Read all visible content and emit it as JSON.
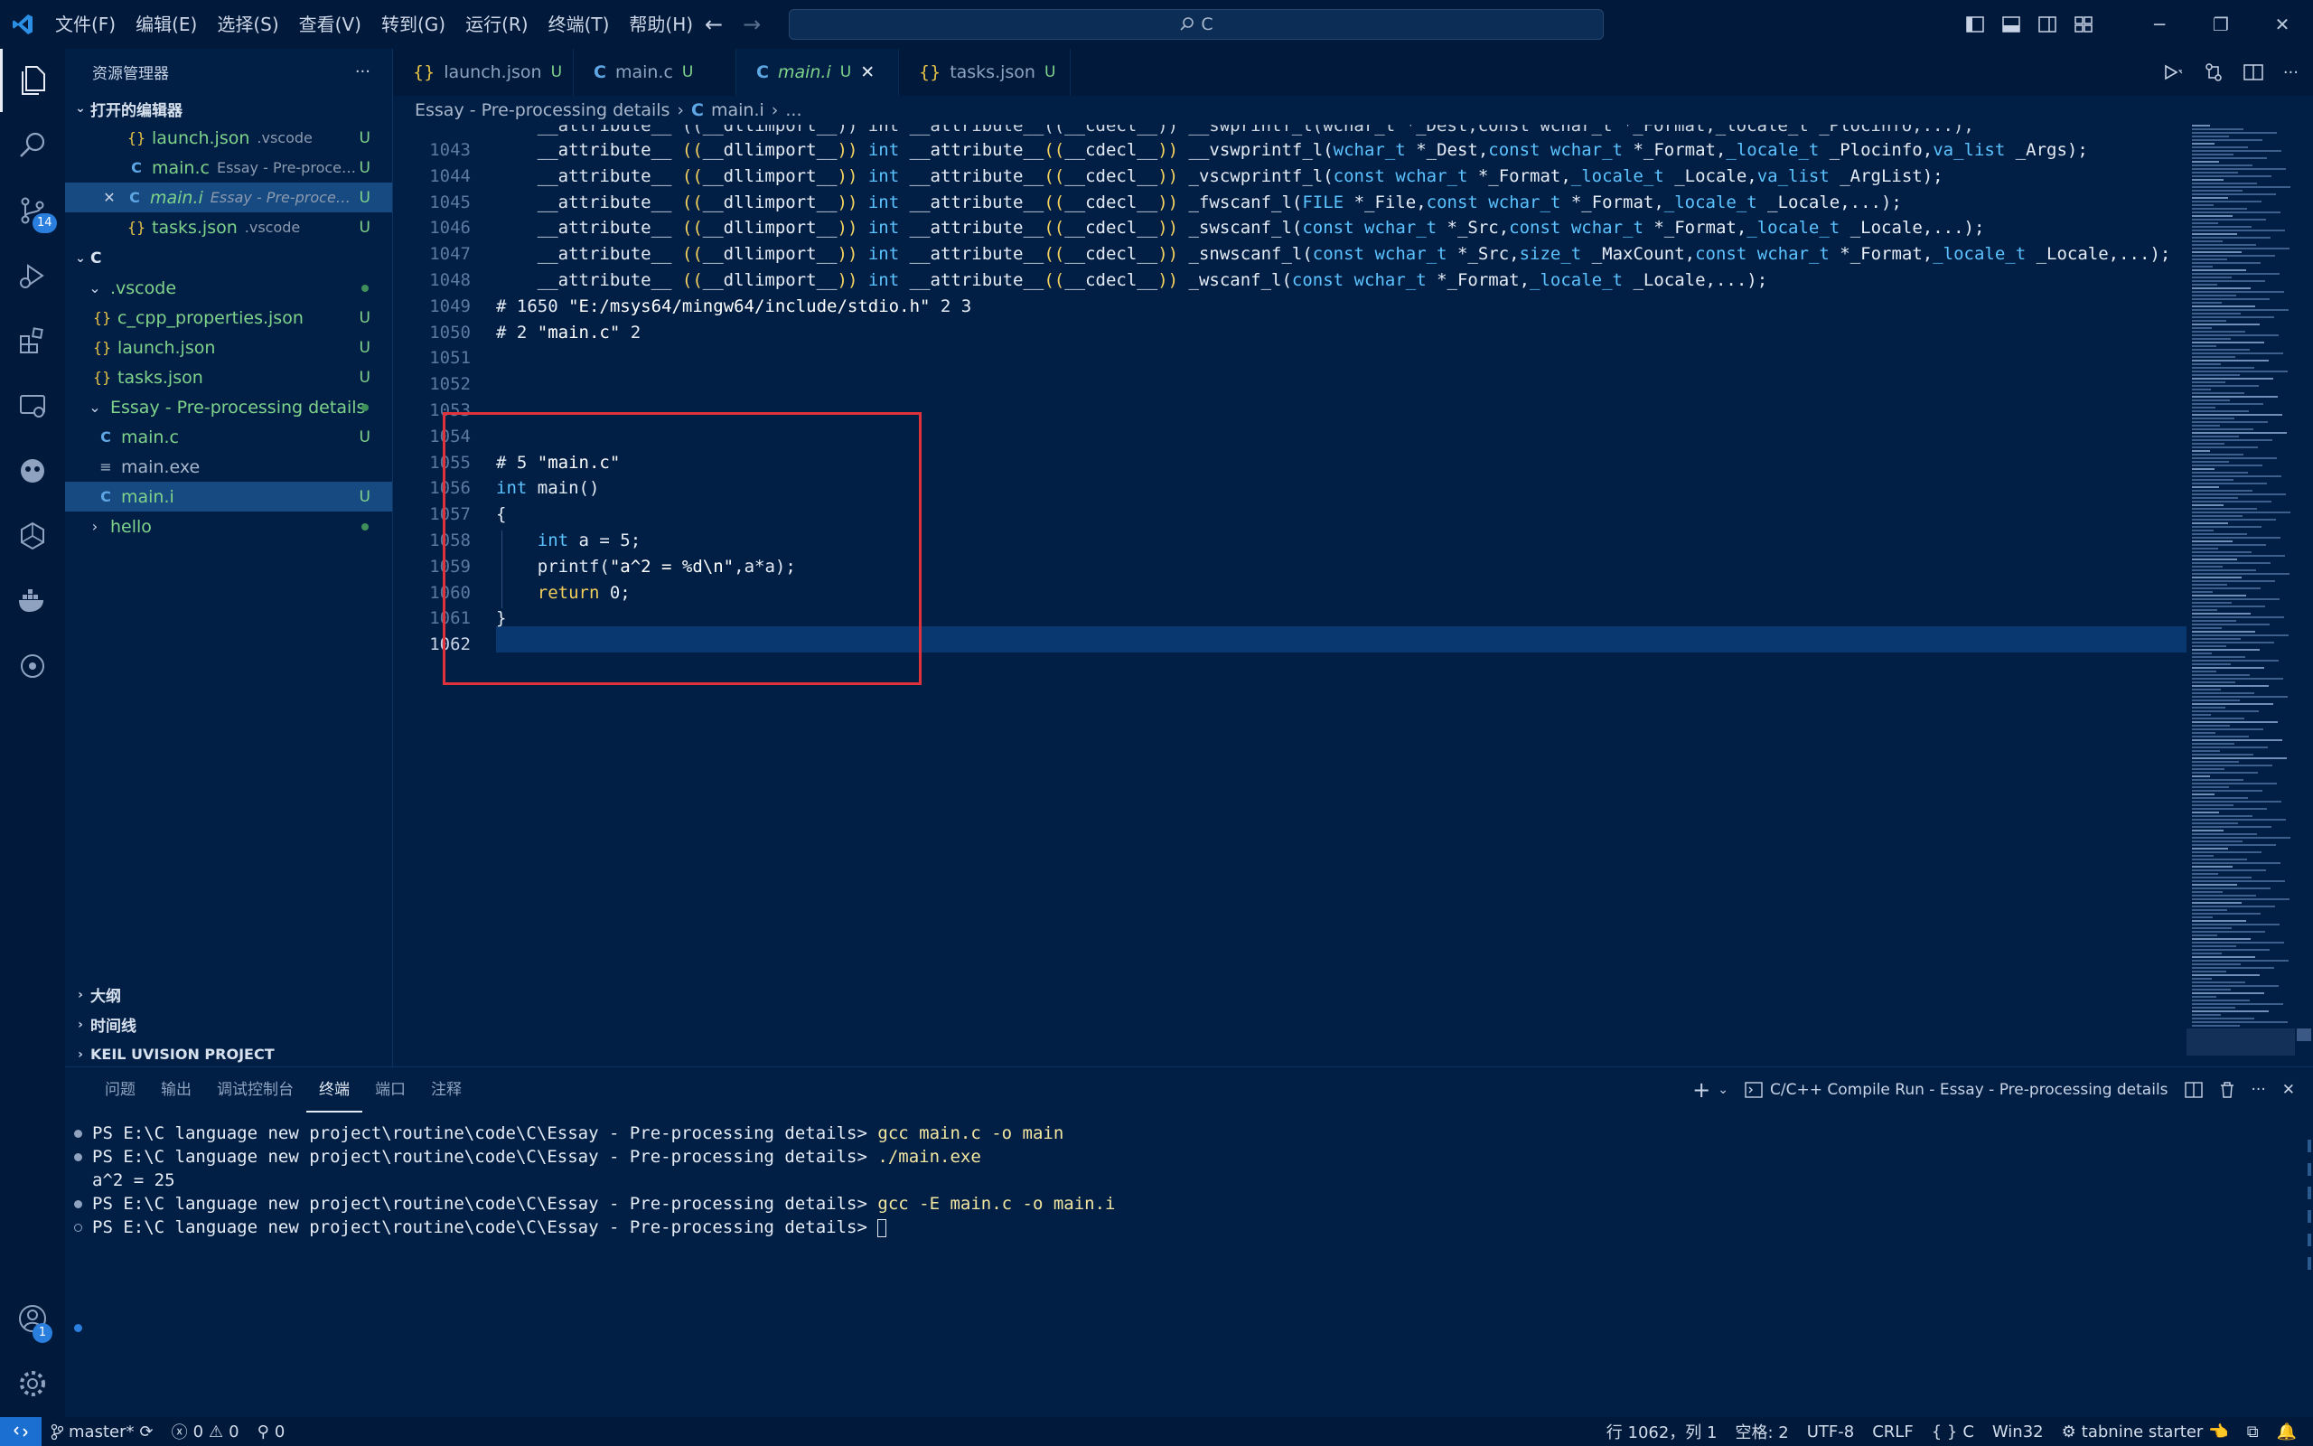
{
  "menu": [
    "文件(F)",
    "编辑(E)",
    "选择(S)",
    "查看(V)",
    "转到(G)",
    "运行(R)",
    "终端(T)",
    "帮助(H)"
  ],
  "search": {
    "text": "C"
  },
  "activity": {
    "scm_badge": "14",
    "accounts_badge": "1"
  },
  "sidebar": {
    "title": "资源管理器",
    "more": "···",
    "open_editors": {
      "header": "打开的编辑器",
      "items": [
        {
          "name": "launch.json",
          "path": ".vscode",
          "git": "U"
        },
        {
          "name": "main.c",
          "path": "Essay - Pre-proces...",
          "git": "U"
        },
        {
          "name": "main.i",
          "path": "Essay - Pre-process...",
          "git": "U",
          "close": "✕"
        },
        {
          "name": "tasks.json",
          "path": ".vscode",
          "git": "U"
        }
      ]
    },
    "folder": {
      "header": "C",
      "items": [
        {
          "name": ".vscode"
        },
        {
          "name": "c_cpp_properties.json",
          "git": "U"
        },
        {
          "name": "launch.json",
          "git": "U"
        },
        {
          "name": "tasks.json",
          "git": "U"
        },
        {
          "name": "Essay - Pre-processing details"
        },
        {
          "name": "main.c",
          "git": "U"
        },
        {
          "name": "main.exe"
        },
        {
          "name": "main.i",
          "git": "U"
        },
        {
          "name": "hello"
        }
      ]
    },
    "bottom_sections": [
      "大纲",
      "时间线",
      "KEIL UVISION PROJECT"
    ]
  },
  "tabs": [
    {
      "label": "launch.json",
      "mark": "U",
      "icon": "{}"
    },
    {
      "label": "main.c",
      "mark": "U",
      "icon": "C"
    },
    {
      "label": "main.i",
      "mark": "U",
      "icon": "C",
      "close": "✕"
    },
    {
      "label": "tasks.json",
      "mark": "U",
      "icon": "{}"
    }
  ],
  "breadcrumb": [
    "Essay - Pre-processing details",
    "main.i",
    "..."
  ],
  "code": {
    "partial_line": "    __attribute__ ((__dllimport__)) int __attribute__((__cdecl__)) __swprintf_l(wchar_t *_Dest,const wchar_t *_Format,_locale_t _Plocinfo,...);",
    "lines": [
      {
        "n": "1043",
        "t": "    __attribute__ ((__dllimport__)) int __attribute__((__cdecl__)) __vswprintf_l(wchar_t *_Dest,const wchar_t *_Format,_locale_t _Plocinfo,va_list _Args);"
      },
      {
        "n": "1044",
        "t": "    __attribute__ ((__dllimport__)) int __attribute__((__cdecl__)) _vscwprintf_l(const wchar_t *_Format,_locale_t _Locale,va_list _ArgList);"
      },
      {
        "n": "1045",
        "t": "    __attribute__ ((__dllimport__)) int __attribute__((__cdecl__)) _fwscanf_l(FILE *_File,const wchar_t *_Format,_locale_t _Locale,...);"
      },
      {
        "n": "1046",
        "t": "    __attribute__ ((__dllimport__)) int __attribute__((__cdecl__)) _swscanf_l(const wchar_t *_Src,const wchar_t *_Format,_locale_t _Locale,...);"
      },
      {
        "n": "1047",
        "t": "    __attribute__ ((__dllimport__)) int __attribute__((__cdecl__)) _snwscanf_l(const wchar_t *_Src,size_t _MaxCount,const wchar_t *_Format,_locale_t _Locale,...);"
      },
      {
        "n": "1048",
        "t": "    __attribute__ ((__dllimport__)) int __attribute__((__cdecl__)) _wscanf_l(const wchar_t *_Format,_locale_t _Locale,...);"
      },
      {
        "n": "1049",
        "t": "# 1650 \"E:/msys64/mingw64/include/stdio.h\" 2 3"
      },
      {
        "n": "1050",
        "t": "# 2 \"main.c\" 2"
      },
      {
        "n": "1051",
        "t": ""
      },
      {
        "n": "1052",
        "t": ""
      },
      {
        "n": "1053",
        "t": ""
      },
      {
        "n": "1054",
        "t": ""
      },
      {
        "n": "1055",
        "t": "# 5 \"main.c\""
      },
      {
        "n": "1056",
        "t": "int main()"
      },
      {
        "n": "1057",
        "t": "{"
      },
      {
        "n": "1058",
        "t": "    int a = 5;"
      },
      {
        "n": "1059",
        "t": "    printf(\"a^2 = %d\\n\",a*a);"
      },
      {
        "n": "1060",
        "t": "    return 0;"
      },
      {
        "n": "1061",
        "t": "}"
      },
      {
        "n": "1062",
        "t": ""
      }
    ]
  },
  "panel": {
    "tabs": [
      "问题",
      "输出",
      "调试控制台",
      "终端",
      "端口",
      "注释"
    ],
    "active_tab": "终端",
    "task_label": "C/C++ Compile Run - Essay - Pre-processing details",
    "terminal": [
      {
        "prompt": "PS E:\\C language new project\\routine\\code\\C\\Essay - Pre-processing details> ",
        "cmd": "gcc main.c -o main",
        "marker": "filled"
      },
      {
        "prompt": "PS E:\\C language new project\\routine\\code\\C\\Essay - Pre-processing details> ",
        "cmd": "./main.exe",
        "marker": "filled"
      },
      {
        "prompt": "a^2 = 25",
        "cmd": "",
        "marker": "none"
      },
      {
        "prompt": "PS E:\\C language new project\\routine\\code\\C\\Essay - Pre-processing details> ",
        "cmd": "gcc -E main.c -o main.i",
        "marker": "filled"
      },
      {
        "prompt": "PS E:\\C language new project\\routine\\code\\C\\Essay - Pre-processing details> ",
        "cmd": "",
        "marker": "hollow"
      }
    ]
  },
  "status": {
    "branch": "master*",
    "errors": "0",
    "warnings": "0",
    "ports": "0",
    "position": "行 1062，列 1",
    "spaces": "空格: 2",
    "encoding": "UTF-8",
    "eol": "CRLF",
    "language": "C",
    "platform": "Win32",
    "tabnine": "tabnine starter"
  },
  "colors": {
    "background": "#011f45",
    "accent": "#1a6fd1",
    "git_untracked": "#7fd38a",
    "highlight_box": "#e0323a"
  }
}
